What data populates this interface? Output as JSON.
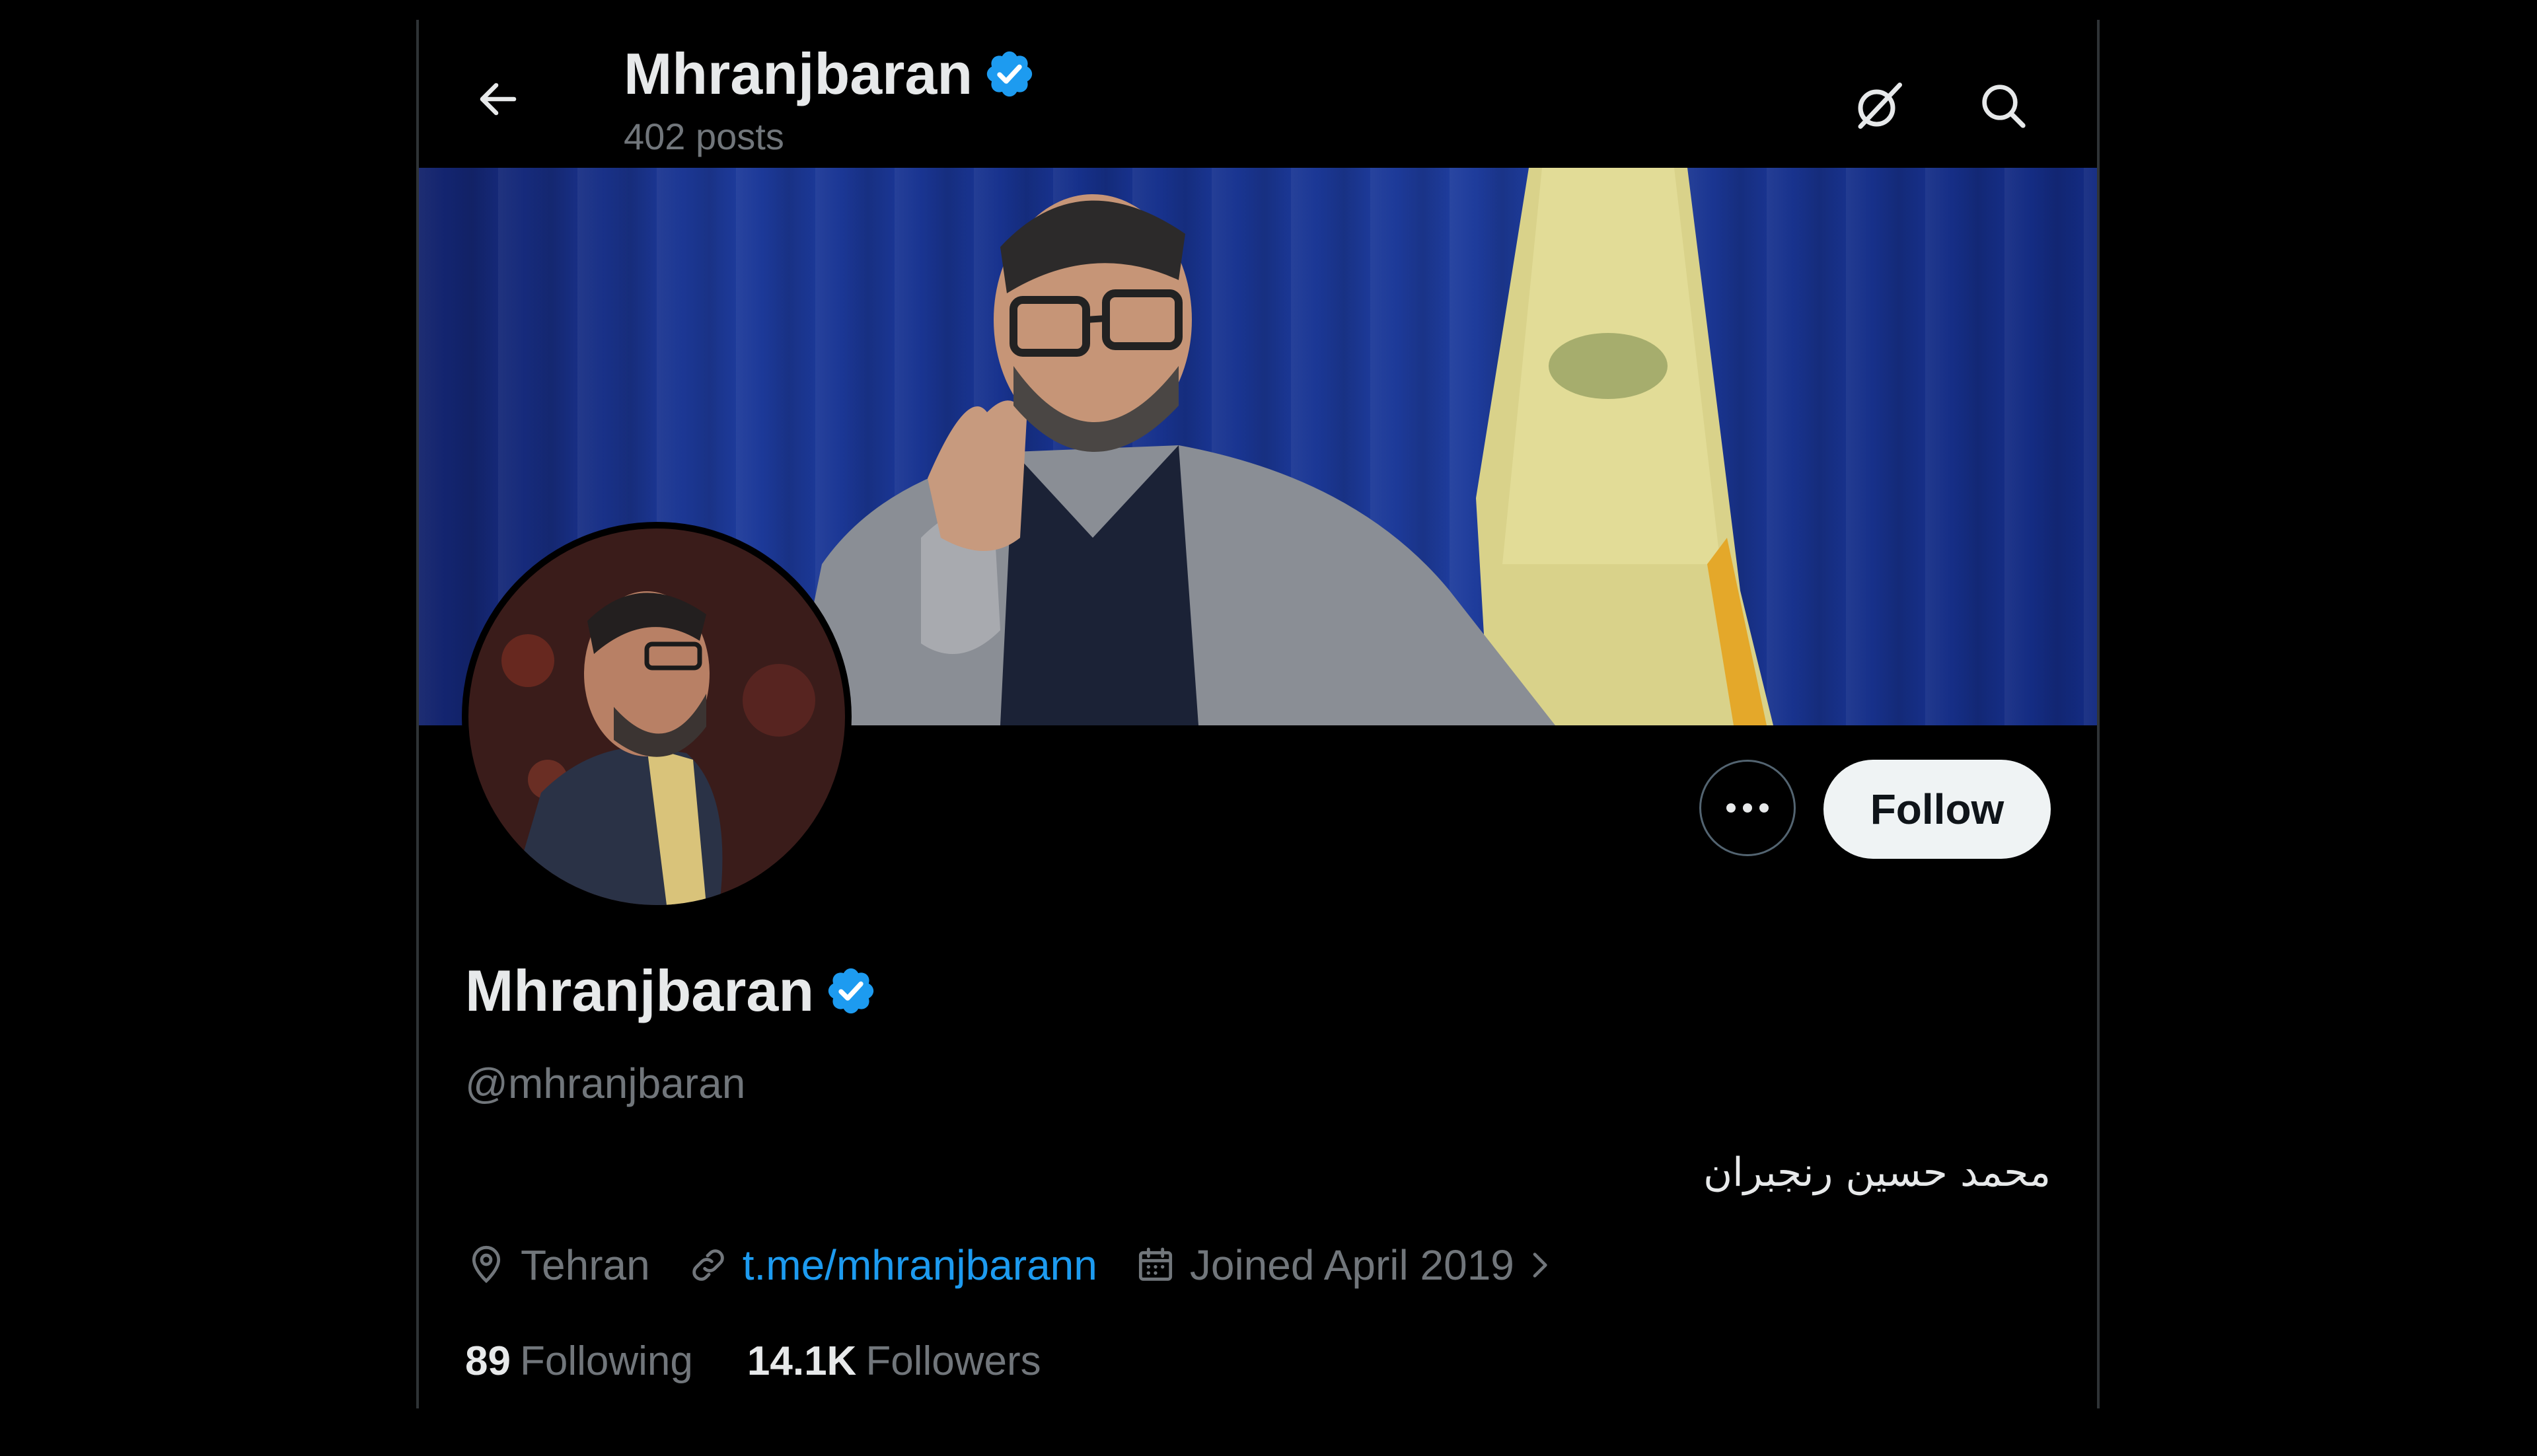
{
  "header": {
    "title": "Mhranjbaran",
    "posts_count": "402 posts"
  },
  "profile": {
    "display_name": "Mhranjbaran",
    "handle": "@mhranjbaran",
    "bio": "محمد حسین رنجبران",
    "location": "Tehran",
    "website": "t.me/mhranjbarann",
    "joined": "Joined April 2019",
    "following_count": "89",
    "following_label": "Following",
    "followers_count": "14.1K",
    "followers_label": "Followers"
  },
  "actions": {
    "follow_label": "Follow"
  },
  "colors": {
    "background": "#000000",
    "primary_text": "#e7e9ea",
    "secondary_text": "#71767b",
    "accent": "#1d9bf0",
    "follow_button_bg": "#eff3f4"
  },
  "icons": {
    "back": "arrow-left-icon",
    "grok": "grok-icon",
    "search": "search-icon",
    "verified": "verified-badge-icon",
    "more": "more-horizontal-icon",
    "location": "location-pin-icon",
    "link": "link-icon",
    "calendar": "calendar-icon",
    "chevron": "chevron-right-icon"
  }
}
